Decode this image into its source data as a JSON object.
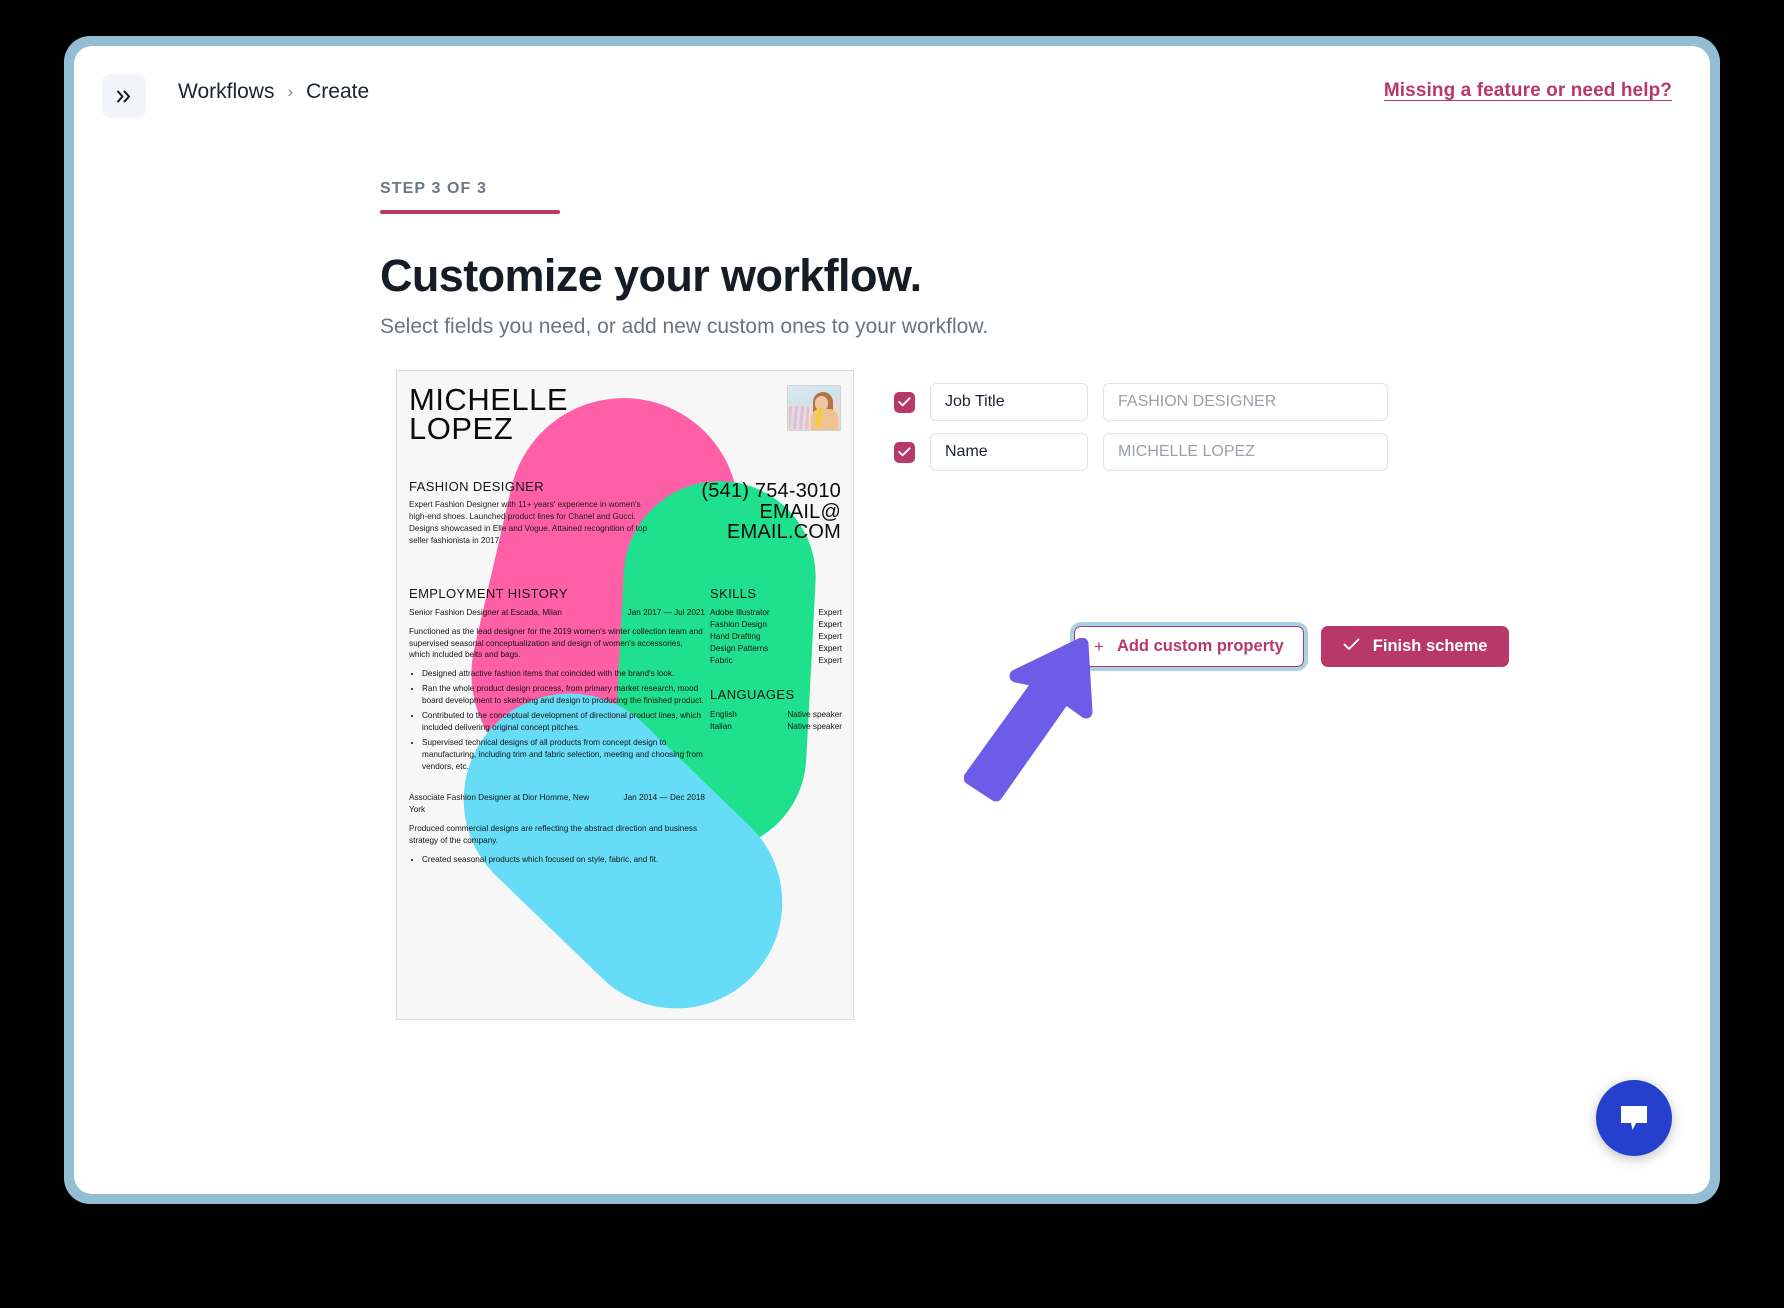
{
  "topbar": {
    "collapse_icon": "chevrons-right-icon",
    "breadcrumb": {
      "root": "Workflows",
      "separator": "›",
      "current": "Create"
    },
    "help_link": "Missing a feature or need help?"
  },
  "header": {
    "step_label": "STEP 3 OF 3",
    "title": "Customize your workflow.",
    "subtitle": "Select fields you need, or add new custom ones to your workflow."
  },
  "resume": {
    "name": "MICHELLE\nLOPEZ",
    "role": "FASHION DESIGNER",
    "summary": "Expert Fashion Designer with 11+ years' experience in women's high-end shoes. Launched product lines for Chanel and Gucci. Designs showcased in Elle and Vogue. Attained recognition of top seller fashionista in 2017.",
    "phone": "(541) 754-3010",
    "email_line1": "EMAIL@",
    "email_line2": "EMAIL.COM",
    "employment_title": "EMPLOYMENT HISTORY",
    "jobs": [
      {
        "who": "Senior Fashion Designer  at Escada, Milan",
        "when": "Jan 2017 — Jul 2021",
        "desc": "Functioned as the lead designer for the 2019 women's winter collection team and supervised seasonal conceptualization and design of women's accessories, which included belts and bags.",
        "bullets": [
          "Designed attractive fashion items that coincided with the brand's look.",
          "Ran the whole product design process, from primary market research, mood board development to sketching and design to producing the finished product.",
          "Contributed to the conceptual development of directional product lines, which included delivering original concept pitches.",
          "Supervised technical designs of all products from concept design to manufacturing, including trim and fabric selection, meeting and choosing from vendors, etc."
        ]
      },
      {
        "who": "Associate Fashion Designer at Dior Homme, New York",
        "when": "Jan 2014 — Dec 2018",
        "desc": "Produced commercial designs are reflecting the abstract direction and business strategy of the company.",
        "bullets": [
          "Created seasonal products which focused on style, fabric, and fit."
        ]
      }
    ],
    "skills_title": "SKILLS",
    "skills": [
      {
        "k": "Adobe Illustrator",
        "v": "Expert"
      },
      {
        "k": "Fashion Design",
        "v": "Expert"
      },
      {
        "k": "Hand Drafting",
        "v": "Expert"
      },
      {
        "k": "Design Patterns",
        "v": "Expert"
      },
      {
        "k": "Fabric",
        "v": "Expert"
      }
    ],
    "languages_title": "LANGUAGES",
    "languages": [
      {
        "k": "English",
        "v": "Native speaker"
      },
      {
        "k": "Italian",
        "v": "Native speaker"
      }
    ],
    "blob_colors": {
      "pink": "#ff5fa6",
      "green": "#1fe08c",
      "blue": "#66dcf7"
    }
  },
  "fields": [
    {
      "checked": true,
      "key": "Job Title",
      "value": "FASHION DESIGNER"
    },
    {
      "checked": true,
      "key": "Name",
      "value": "MICHELLE LOPEZ"
    }
  ],
  "buttons": {
    "add_custom": "Add custom property",
    "add_custom_plus": "+",
    "finish": "Finish scheme"
  },
  "chat": {
    "icon": "chat-bubble-icon"
  },
  "colors": {
    "accent": "#b8386a",
    "frame_border": "#93bdd2",
    "focus_ring": "#a9d2e6",
    "chat_blue": "#2540cc",
    "arrow_purple": "#6c5ce7"
  }
}
